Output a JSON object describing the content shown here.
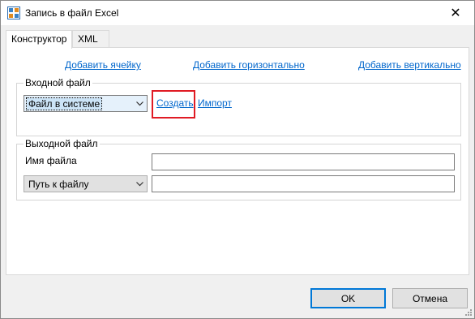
{
  "window": {
    "title": "Запись в файл Excel",
    "app_icon": "excel-grid-icon",
    "close_icon": "close-icon",
    "close_glyph": "✕"
  },
  "tabs": [
    {
      "label": "Конструктор",
      "active": true
    },
    {
      "label": "XML",
      "active": false
    }
  ],
  "toolbar": {
    "add_cell": "Добавить ячейку",
    "add_horizontal": "Добавить горизонтально",
    "add_vertical": "Добавить вертикально"
  },
  "input_file": {
    "legend": "Входной файл",
    "source_select": "Файл в системе",
    "create_link": "Создать",
    "import_link": "Импорт"
  },
  "output_file": {
    "legend": "Выходной файл",
    "file_name_label": "Имя файла",
    "file_name_value": "",
    "path_select": "Путь к файлу",
    "path_value": ""
  },
  "buttons": {
    "ok": "OK",
    "cancel": "Отмена"
  },
  "colors": {
    "link": "#0066cc",
    "highlight_box": "#e01b24",
    "default_button_border": "#0078d7"
  }
}
